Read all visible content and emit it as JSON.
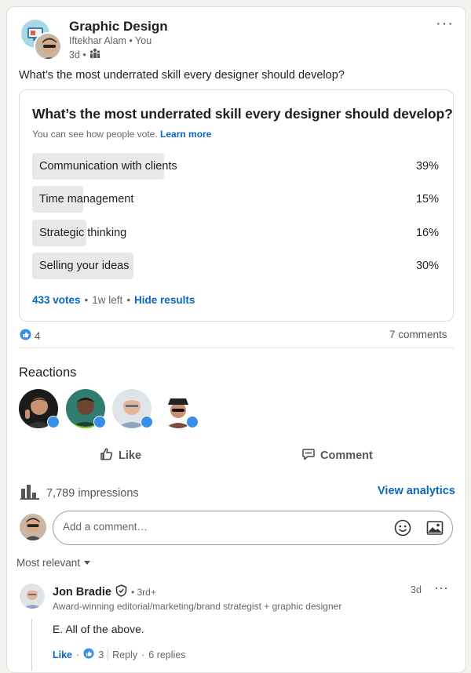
{
  "post": {
    "group_name": "Graphic Design",
    "author": "Iftekhar Alam",
    "author_suffix": "• You",
    "age": "3d •",
    "text": "What’s the most underrated skill every designer should develop?"
  },
  "poll": {
    "question": "What’s the most underrated skill every designer should develop?",
    "note": "You can see how people vote.",
    "learn_more": "Learn more",
    "options": [
      {
        "label": "Communication with clients",
        "pct_text": "39%",
        "pct": 39
      },
      {
        "label": "Time management",
        "pct_text": "15%",
        "pct": 15
      },
      {
        "label": "Strategic thinking",
        "pct_text": "16%",
        "pct": 16
      },
      {
        "label": "Selling your ideas",
        "pct_text": "30%",
        "pct": 30
      }
    ],
    "votes": "433 votes",
    "time_left": "1w left",
    "hide_results": "Hide results"
  },
  "social": {
    "reaction_count": "4",
    "comments": "7 comments",
    "reactions_title": "Reactions"
  },
  "actions": {
    "like": "Like",
    "comment": "Comment"
  },
  "stats": {
    "impressions": "7,789 impressions",
    "view_analytics": "View analytics"
  },
  "comment_input": {
    "placeholder": "Add a comment…"
  },
  "sort": {
    "label": "Most relevant"
  },
  "comment": {
    "name": "Jon Bradie",
    "degree": "• 3rd+",
    "time": "3d",
    "headline": "Award-winning editorial/marketing/brand strategist + graphic designer",
    "text": "E. All of the above.",
    "like": "Like",
    "like_count": "3",
    "reply": "Reply",
    "replies": "6 replies"
  },
  "colors": {
    "accent": "#0a66c2",
    "poll_fill": "#e8e8e8",
    "like_badge": "#378fe9"
  }
}
